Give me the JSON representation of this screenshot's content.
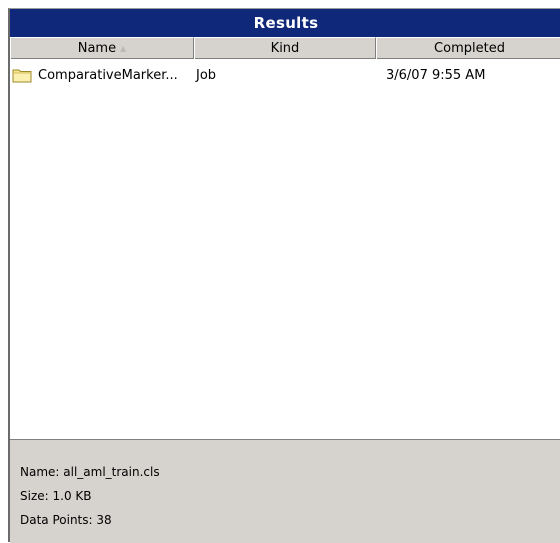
{
  "panel": {
    "title": "Results"
  },
  "columns": {
    "name": "Name",
    "kind": "Kind",
    "completed": "Completed"
  },
  "rows": [
    {
      "name": "ComparativeMarker...",
      "kind": "Job",
      "completed": "3/6/07 9:55 AM",
      "icon": "folder-icon"
    }
  ],
  "details": {
    "name_line": "Name: all_aml_train.cls",
    "size_line": "Size: 1.0 KB",
    "points_line": "Data Points: 38"
  },
  "colors": {
    "titlebar": "#10287a",
    "header_bg": "#d6d3ce",
    "folder": "#f4e38a"
  }
}
